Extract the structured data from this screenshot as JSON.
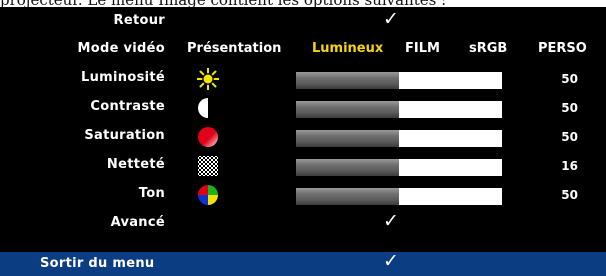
{
  "caption": "projecteur. Le menu Image contient les options suivantes :",
  "menu": {
    "back": {
      "label": "Retour",
      "check": "✓"
    },
    "video_mode": {
      "label": "Mode vidéo",
      "options": [
        "Présentation",
        "Lumineux",
        "FILM",
        "sRGB",
        "PERSO"
      ],
      "selected": "Lumineux",
      "selected_color": "#f5d60a"
    },
    "sliders": [
      {
        "label": "Luminosité",
        "icon": "sun-icon",
        "value": "50",
        "fill_percent": 50
      },
      {
        "label": "Contraste",
        "icon": "contrast-icon",
        "value": "50",
        "fill_percent": 50
      },
      {
        "label": "Saturation",
        "icon": "saturation-icon",
        "value": "50",
        "fill_percent": 50
      },
      {
        "label": "Netteté",
        "icon": "sharpness-icon",
        "value": "16",
        "fill_percent": 50
      },
      {
        "label": "Ton",
        "icon": "tint-icon",
        "value": "50",
        "fill_percent": 50
      }
    ],
    "advanced": {
      "label": "Avancé",
      "check": "✓"
    },
    "exit": {
      "label": "Sortir du menu",
      "check": "✓",
      "background": "#0b3d83"
    }
  }
}
